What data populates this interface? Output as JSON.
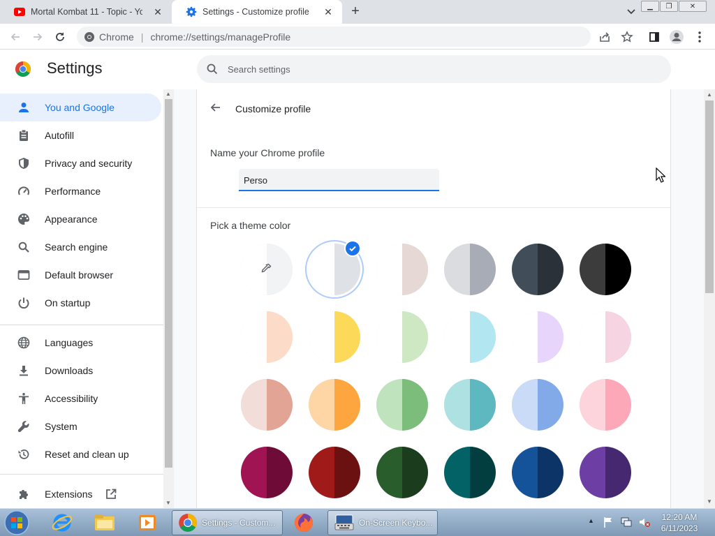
{
  "tabs": [
    {
      "title": "Mortal Kombat 11 - Topic - YouTube",
      "icon": "youtube-icon"
    },
    {
      "title": "Settings - Customize profile",
      "icon": "settings-gear-icon"
    }
  ],
  "toolbar": {
    "site_label": "Chrome",
    "separator": "|",
    "url": "chrome://settings/manageProfile"
  },
  "header": {
    "title": "Settings",
    "search_placeholder": "Search settings"
  },
  "sidebar": {
    "items": [
      {
        "label": "You and Google",
        "icon": "person-icon",
        "active": true
      },
      {
        "label": "Autofill",
        "icon": "clipboard-icon"
      },
      {
        "label": "Privacy and security",
        "icon": "shield-icon"
      },
      {
        "label": "Performance",
        "icon": "speedometer-icon"
      },
      {
        "label": "Appearance",
        "icon": "palette-icon"
      },
      {
        "label": "Search engine",
        "icon": "search-icon"
      },
      {
        "label": "Default browser",
        "icon": "browser-window-icon"
      },
      {
        "label": "On startup",
        "icon": "power-icon"
      },
      {
        "label": "Languages",
        "icon": "globe-icon"
      },
      {
        "label": "Downloads",
        "icon": "download-icon"
      },
      {
        "label": "Accessibility",
        "icon": "accessibility-icon"
      },
      {
        "label": "System",
        "icon": "wrench-icon"
      },
      {
        "label": "Reset and clean up",
        "icon": "restore-icon"
      },
      {
        "label": "Extensions",
        "icon": "puzzle-icon"
      }
    ]
  },
  "main": {
    "page_title": "Customize profile",
    "name_label": "Name your Chrome profile",
    "name_value": "Perso",
    "theme_label": "Pick a theme color",
    "selected_theme_index": 1,
    "theme_colors": [
      [
        "#ffffff",
        "#f1f3f4"
      ],
      [
        "#ffffff",
        "#dee1e6"
      ],
      [
        "#ffffff",
        "#e6d8d5"
      ],
      [
        "#dadce0",
        "#a8acb6"
      ],
      [
        "#414e59",
        "#2a3138"
      ],
      [
        "#3c3c3c",
        "#000000"
      ],
      [
        "#ffffff",
        "#fcdcc8"
      ],
      [
        "#ffffff",
        "#fdd95a"
      ],
      [
        "#ffffff",
        "#cde8c3"
      ],
      [
        "#ffffff",
        "#b2e6f0"
      ],
      [
        "#ffffff",
        "#e8d5fb"
      ],
      [
        "#ffffff",
        "#f6d4e2"
      ],
      [
        "#f2ddd8",
        "#e2a595"
      ],
      [
        "#fed6a6",
        "#fda640"
      ],
      [
        "#bfe3bc",
        "#7dbd7b"
      ],
      [
        "#aee1e1",
        "#5db8c0"
      ],
      [
        "#c9dbf6",
        "#83aae8"
      ],
      [
        "#fed4dc",
        "#fca8b8"
      ],
      [
        "#a11453",
        "#6e0b36"
      ],
      [
        "#a11a1a",
        "#6b1111"
      ],
      [
        "#2a5d2c",
        "#1b3d1d"
      ],
      [
        "#036266",
        "#023d40"
      ],
      [
        "#14539a",
        "#0c3467"
      ],
      [
        "#6d3fa5",
        "#452870"
      ]
    ]
  },
  "taskbar": {
    "windows": [
      {
        "label": "Settings - Custom...",
        "icon": "chrome-icon"
      },
      {
        "label": "On-Screen Keybo...",
        "icon": "keyboard-icon"
      }
    ],
    "clock_time": "12:20 AM",
    "clock_date": "6/11/2023"
  }
}
